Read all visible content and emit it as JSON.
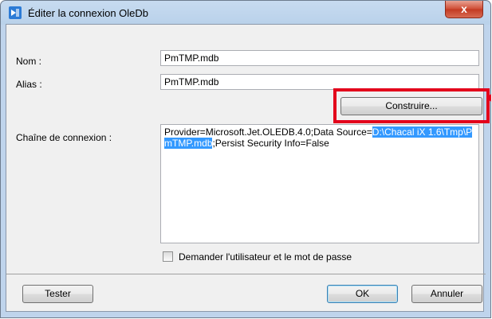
{
  "window": {
    "title": "Éditer la connexion OleDb",
    "close_label": "x"
  },
  "form": {
    "name_label": "Nom :",
    "name_value": "PmTMP.mdb",
    "alias_label": "Alias :",
    "alias_value": "PmTMP.mdb",
    "build_button": "Construire...",
    "connection_label": "Chaîne de connexion :",
    "connection_string": {
      "before": "Provider=Microsoft.Jet.OLEDB.4.0;Data Source=",
      "selected": "D:\\Chacal iX 1.6\\Tmp\\PmTMP.mdb",
      "after": ";Persist Security Info=False"
    },
    "ask_credentials_label": "Demander l'utilisateur et le mot de passe",
    "ask_credentials_checked": false
  },
  "buttons": {
    "test": "Tester",
    "ok": "OK",
    "cancel": "Annuler"
  },
  "colors": {
    "highlight": "#e3001b",
    "selection": "#3399ff"
  }
}
